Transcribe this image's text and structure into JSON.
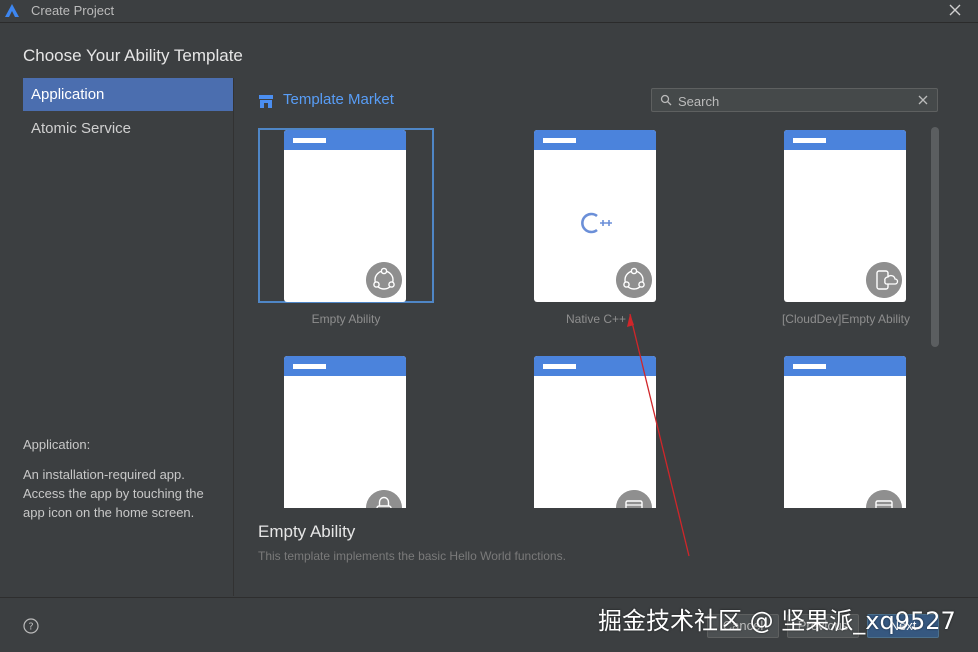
{
  "window": {
    "title": "Create Project"
  },
  "heading": "Choose Your Ability Template",
  "sidebar": {
    "items": [
      {
        "label": "Application",
        "active": true
      },
      {
        "label": "Atomic Service",
        "active": false
      }
    ],
    "description_title": "Application:",
    "description_text": "An installation-required app. Access the app by touching the app icon on the home screen."
  },
  "market": {
    "label": "Template Market",
    "icon": "store-icon"
  },
  "search": {
    "placeholder": "Search",
    "value": ""
  },
  "templates": [
    {
      "label": "Empty Ability",
      "badge_icon": "ability-icon",
      "selected": true
    },
    {
      "label": "Native C++",
      "badge_icon": "ability-icon",
      "center_icon": "cpp-logo-icon",
      "selected": false
    },
    {
      "label": "[CloudDev]Empty Ability",
      "badge_icon": "cloud-device-icon",
      "selected": false
    },
    {
      "label": "",
      "badge_icon": "lock-icon",
      "selected": false
    },
    {
      "label": "",
      "badge_icon": "window-icon",
      "selected": false
    },
    {
      "label": "",
      "badge_icon": "window-icon",
      "selected": false
    }
  ],
  "selected_template": {
    "title": "Empty Ability",
    "description": "This template implements the basic Hello World functions."
  },
  "buttons": {
    "cancel": "Cancel",
    "previous": "Previous",
    "next": "Next"
  },
  "watermark": "掘金技术社区 @ 坚果派_xq9527",
  "colors": {
    "accent": "#4b6eaf",
    "link": "#589df6",
    "phone_bar": "#4b83dc",
    "annotation_arrow": "#d0262a"
  }
}
